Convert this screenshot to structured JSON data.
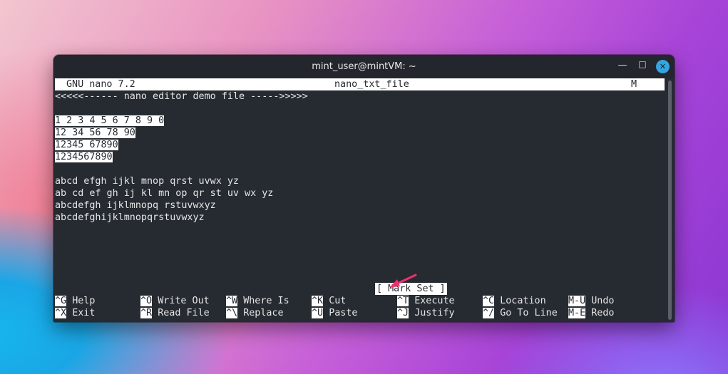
{
  "window": {
    "title": "mint_user@mintVM: ~"
  },
  "nano": {
    "version": "GNU nano 7.2",
    "filename": "nano_txt_file",
    "modified_flag": "M"
  },
  "buffer": {
    "header": "<<<<<------ nano editor demo file ----->>>>>",
    "selected_lines": [
      "1 2 3 4 5 6 7 8 9 0",
      "12 34 56 78 90",
      "12345 67890",
      "1234567890"
    ],
    "plain_lines": [
      "abcd efgh ijkl mnop qrst uvwx yz",
      "ab cd ef gh ij kl mn op qr st uv wx yz",
      "abcdefgh ijklmnopq rstuvwxyz",
      "abcdefghijklmnopqrstuvwxyz"
    ]
  },
  "status_message": "[ Mark Set ]",
  "shortcuts": [
    {
      "key": "^G",
      "label": "Help"
    },
    {
      "key": "^O",
      "label": "Write Out"
    },
    {
      "key": "^W",
      "label": "Where Is"
    },
    {
      "key": "^K",
      "label": "Cut"
    },
    {
      "key": "^T",
      "label": "Execute"
    },
    {
      "key": "^C",
      "label": "Location"
    },
    {
      "key": "M-U",
      "label": "Undo"
    },
    {
      "key": "^X",
      "label": "Exit"
    },
    {
      "key": "^R",
      "label": "Read File"
    },
    {
      "key": "^\\",
      "label": "Replace"
    },
    {
      "key": "^U",
      "label": "Paste"
    },
    {
      "key": "^J",
      "label": "Justify"
    },
    {
      "key": "^/",
      "label": "Go To Line"
    },
    {
      "key": "M-E",
      "label": "Redo"
    }
  ],
  "colors": {
    "accent_arrow": "#f0306a",
    "close_button": "#35a5e0",
    "terminal_bg": "#262a31"
  }
}
